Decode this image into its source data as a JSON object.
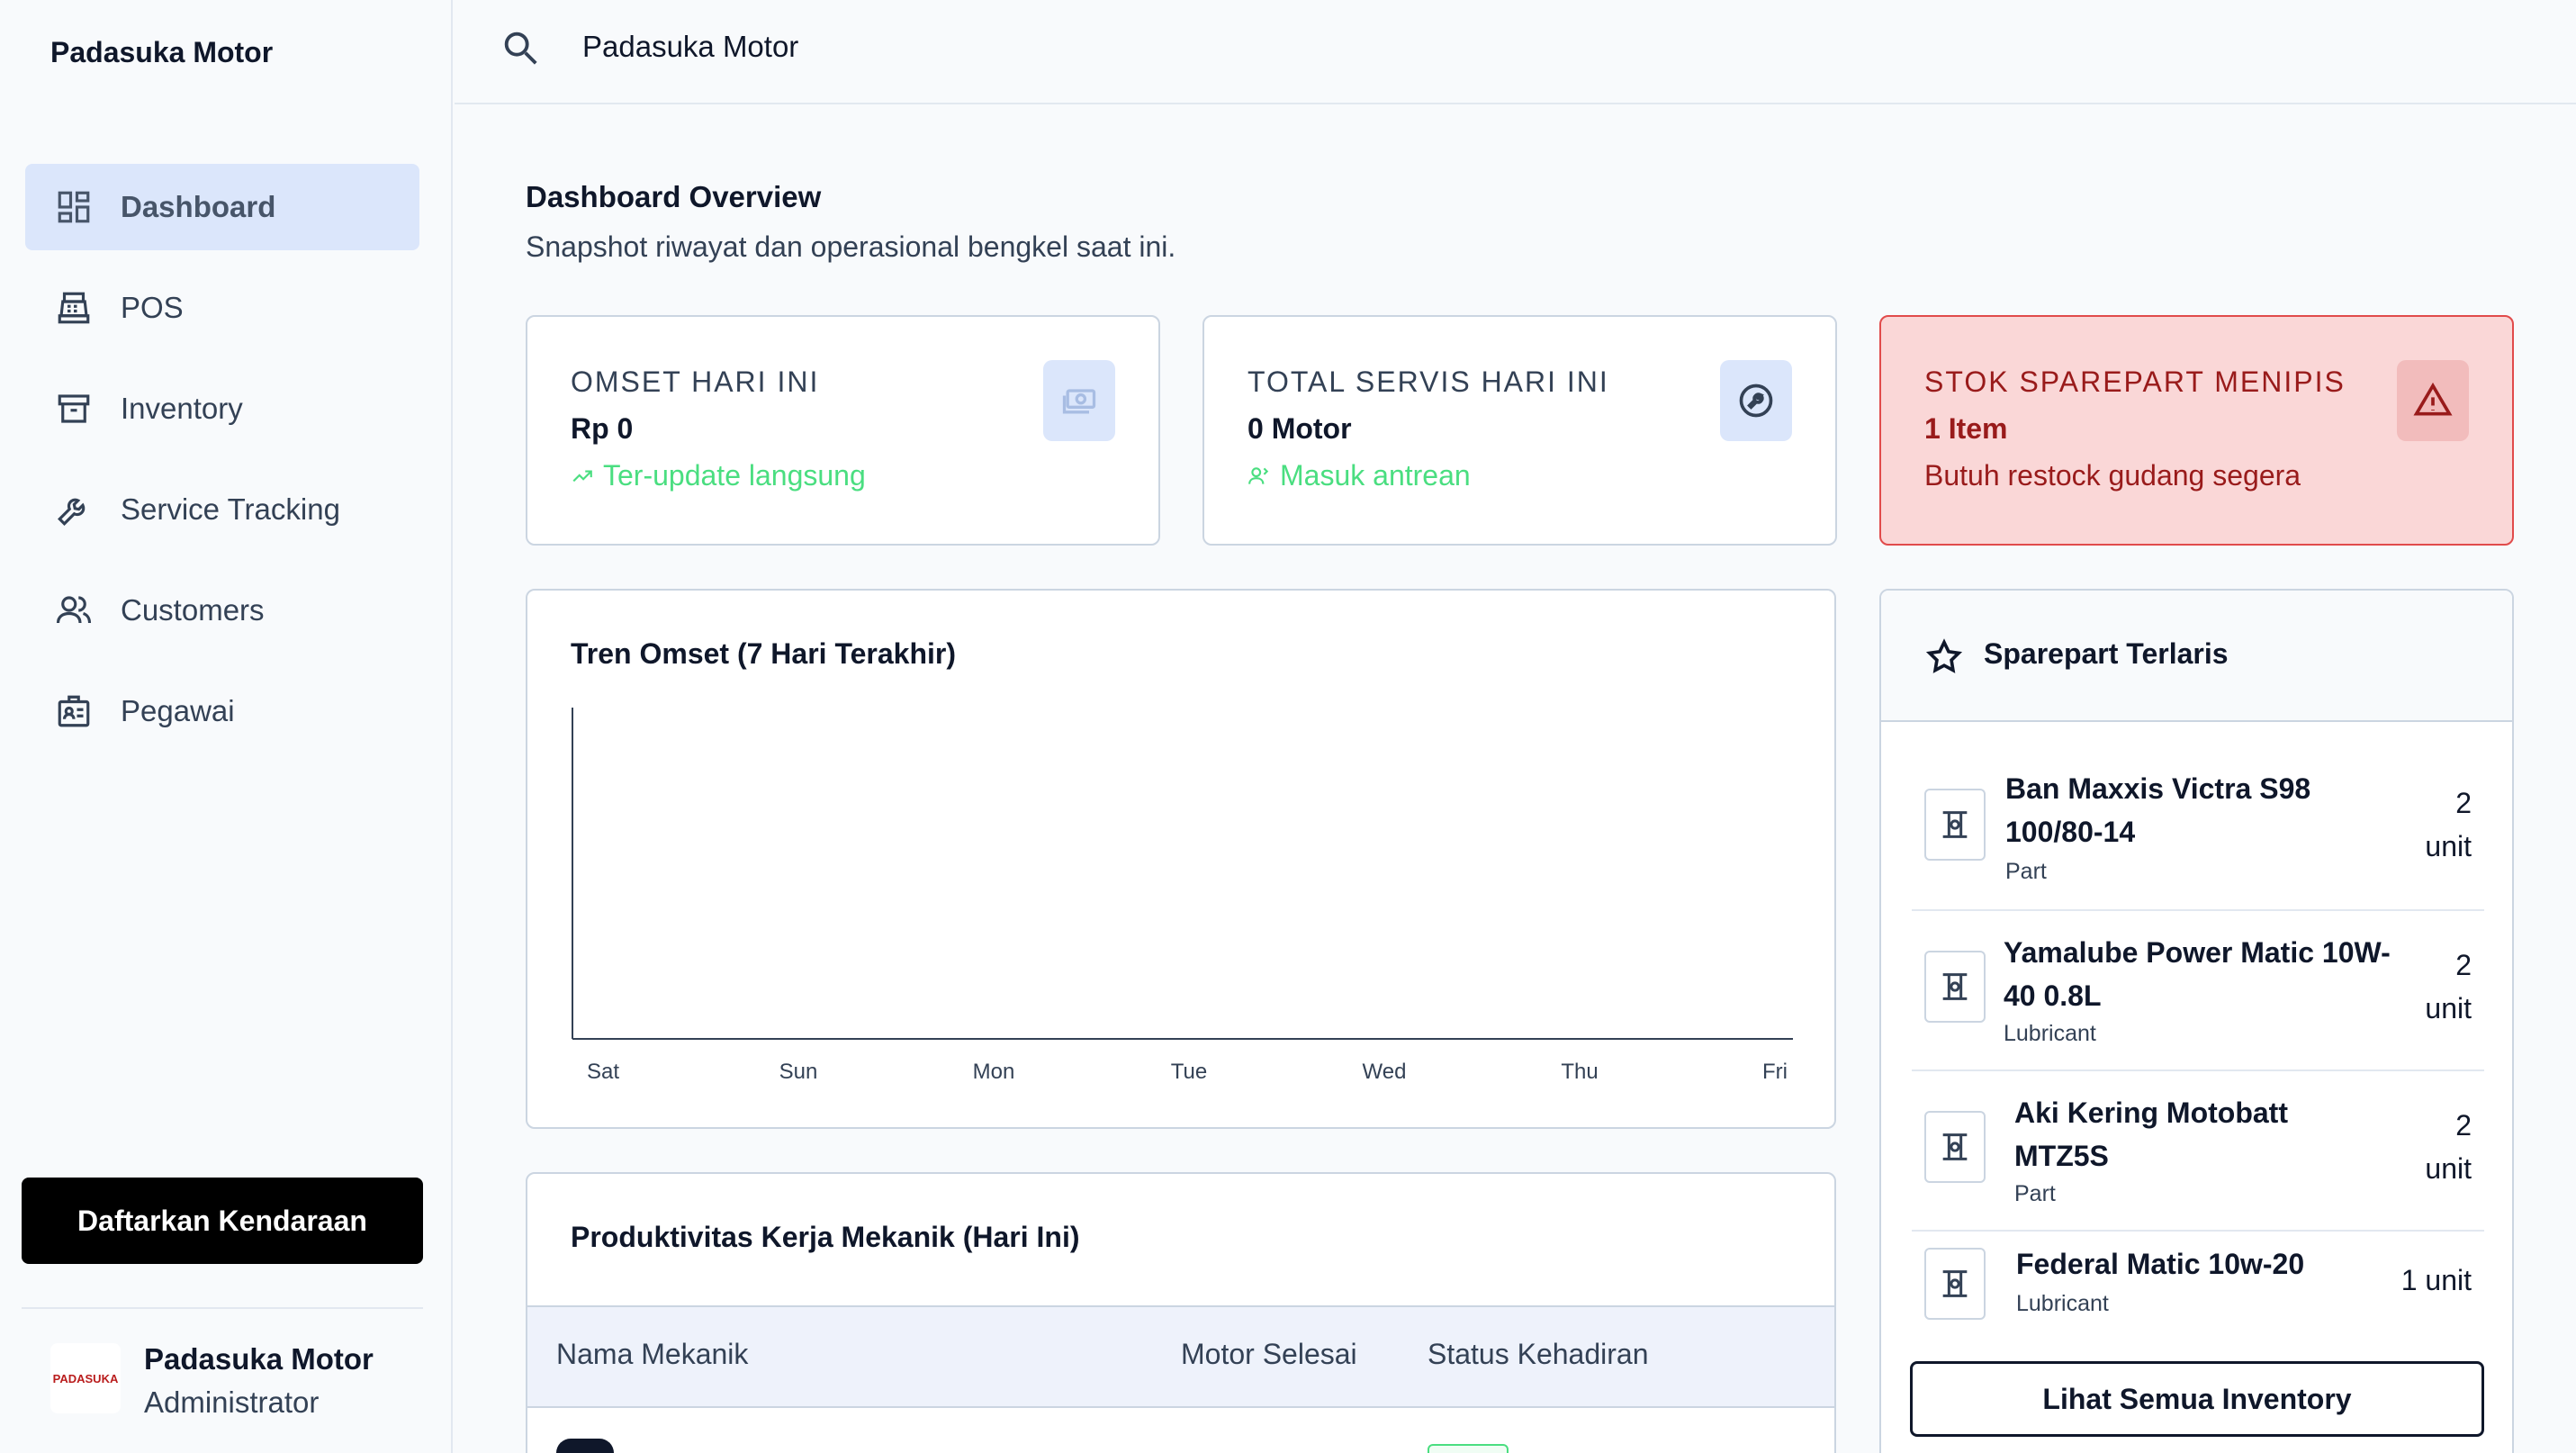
{
  "app": {
    "brand": "Padasuka Motor"
  },
  "sidebar": {
    "items": [
      {
        "label": "Dashboard",
        "icon": "dashboard-icon",
        "active": true
      },
      {
        "label": "POS",
        "icon": "register-icon"
      },
      {
        "label": "Inventory",
        "icon": "archive-icon"
      },
      {
        "label": "Service Tracking",
        "icon": "wrench-icon"
      },
      {
        "label": "Customers",
        "icon": "users-icon"
      },
      {
        "label": "Pegawai",
        "icon": "id-badge-icon"
      }
    ],
    "cta_label": "Daftarkan Kendaraan",
    "profile": {
      "logo_text": "PADASUKA",
      "name": "Padasuka Motor",
      "role": "Administrator"
    }
  },
  "topbar": {
    "search_value": "Padasuka Motor"
  },
  "header": {
    "title": "Dashboard Overview",
    "subtitle": "Snapshot riwayat dan operasional bengkel saat ini."
  },
  "stats": [
    {
      "label": "OMSET HARI INI",
      "value": "Rp 0",
      "note": "Ter-update langsung",
      "icon": "cash-icon"
    },
    {
      "label": "TOTAL SERVIS HARI INI",
      "value": "0 Motor",
      "note": "Masuk antrean",
      "icon": "service-icon"
    },
    {
      "label": "STOK SPAREPART MENIPIS",
      "value": "1 Item",
      "note": "Butuh restock gudang segera",
      "icon": "warning-icon"
    }
  ],
  "chart": {
    "title": "Tren Omset (7 Hari Terakhir)"
  },
  "chart_data": {
    "type": "line",
    "title": "Tren Omset (7 Hari Terakhir)",
    "categories": [
      "Sat",
      "Sun",
      "Mon",
      "Tue",
      "Wed",
      "Thu",
      "Fri"
    ],
    "series": [],
    "xlabel": "",
    "ylabel": "",
    "grid": false
  },
  "productivity": {
    "title": "Produktivitas Kerja Mekanik (Hari Ini)",
    "columns": [
      "Nama Mekanik",
      "Motor Selesai",
      "Status Kehadiran"
    ]
  },
  "parts": {
    "title": "Sparepart Terlaris",
    "items": [
      {
        "name": "Ban Maxxis Victra S98 100/80-14",
        "name_lines": [
          "Ban Maxxis Victra S98",
          "100/80-14"
        ],
        "category": "Part",
        "qty_lines": [
          "2",
          "unit"
        ]
      },
      {
        "name": "Yamalube Power Matic 10W-40 0.8L",
        "name_lines": [
          "Yamalube Power Matic 10W-",
          "40 0.8L"
        ],
        "category": "Lubricant",
        "qty_lines": [
          "2",
          "unit"
        ]
      },
      {
        "name": "Aki Kering Motobatt MTZ5S",
        "name_lines": [
          "Aki Kering Motobatt",
          "MTZ5S"
        ],
        "category": "Part",
        "qty_lines": [
          "2",
          "unit"
        ]
      },
      {
        "name": "Federal Matic 10w-20",
        "name_lines": [
          "Federal Matic 10w-20"
        ],
        "category": "Lubricant",
        "qty_lines": [
          "1 unit"
        ]
      }
    ],
    "button_label": "Lihat Semua Inventory"
  },
  "colors": {
    "accent": "#dbe6fb",
    "success": "#4ade80",
    "danger": "#991b1b",
    "danger_bg": "#fad7d7"
  }
}
